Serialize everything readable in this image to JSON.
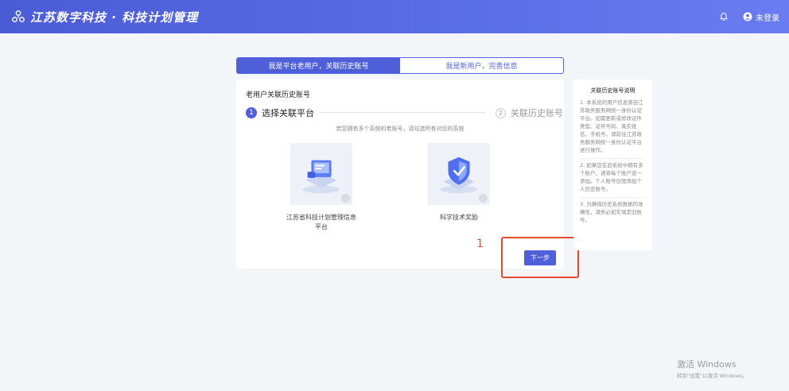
{
  "header": {
    "title": "江苏数字科技 · 科技计划管理",
    "user_label": "未登录"
  },
  "tabs": [
    {
      "label": "我是平台老用户，关联历史账号",
      "active": true
    },
    {
      "label": "我是新用户，完善信息",
      "active": false
    }
  ],
  "card": {
    "title": "老用户关联历史账号",
    "step1": {
      "num": "1",
      "label": "选择关联平台"
    },
    "step2": {
      "num": "2",
      "label": "关联历史账号"
    },
    "hint": "若您拥有多个系统的老账号，请勾选所有对应的系统",
    "options": [
      {
        "label": "江苏省科技计划管理信息平台",
        "icon": "monitor-icon"
      },
      {
        "label": "科学技术奖励",
        "icon": "shield-icon"
      }
    ],
    "next_label": "下一步"
  },
  "annotation": {
    "number": "1"
  },
  "side": {
    "title": "关联历史账号说明",
    "paragraphs": [
      "1. 本系统的用户信息源自江苏政务服务网统一身份认证平台。如需更新或修改证件类型、证件号码、真实姓名、手机号，请前往江苏政务服务网统一身份认证平台进行操作。",
      "2. 如果您在旧系统中拥有多个账户，请将每个账户逐一添加。个人账号仅限添加个人历史账号。",
      "3. 为确保历史系统数据的准确性，请务必如实填定旧账号。"
    ]
  },
  "watermark": {
    "title": "激活 Windows",
    "subtitle": "转到\"设置\"以激活 Windows。"
  },
  "colors": {
    "primary": "#4f5fd9",
    "annotation": "#e34a2e",
    "header": "#5a6ee6"
  }
}
